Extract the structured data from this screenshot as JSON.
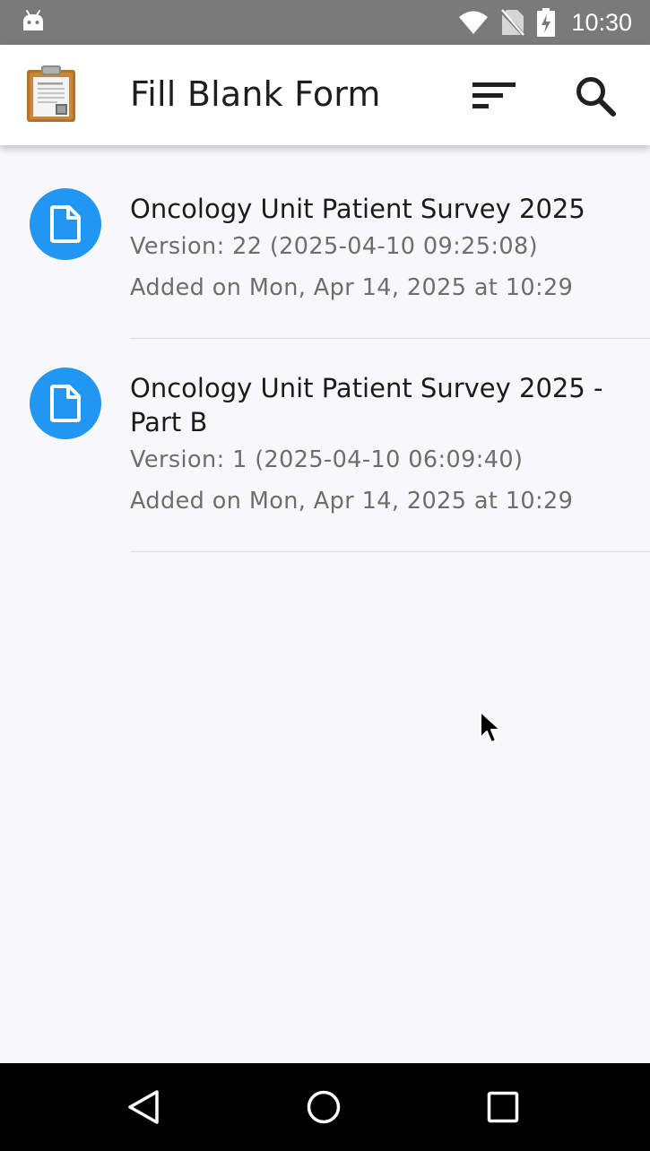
{
  "status_bar": {
    "time": "10:30",
    "icons": [
      "android-icon",
      "wifi-icon",
      "no-sim-icon",
      "battery-charging-icon"
    ]
  },
  "app_bar": {
    "title": "Fill Blank Form",
    "icons": [
      "clipboard-logo-icon",
      "sort-icon",
      "search-icon"
    ]
  },
  "forms": [
    {
      "title": "Oncology Unit Patient Survey 2025",
      "version": "Version: 22 (2025-04-10 09:25:08)",
      "added": "Added on Mon, Apr 14, 2025 at 10:29",
      "icon": "document-icon"
    },
    {
      "title": "Oncology Unit Patient Survey 2025 - Part B",
      "version": "Version: 1 (2025-04-10 06:09:40)",
      "added": "Added on Mon, Apr 14, 2025 at 10:29",
      "icon": "document-icon"
    }
  ],
  "nav_bar": {
    "icons": [
      "back-icon",
      "home-icon",
      "recents-icon"
    ]
  },
  "colors": {
    "accent": "#2196f3",
    "status_bar": "#7a7a7a",
    "background": "#f8f7fa",
    "nav_bar": "#000000"
  }
}
